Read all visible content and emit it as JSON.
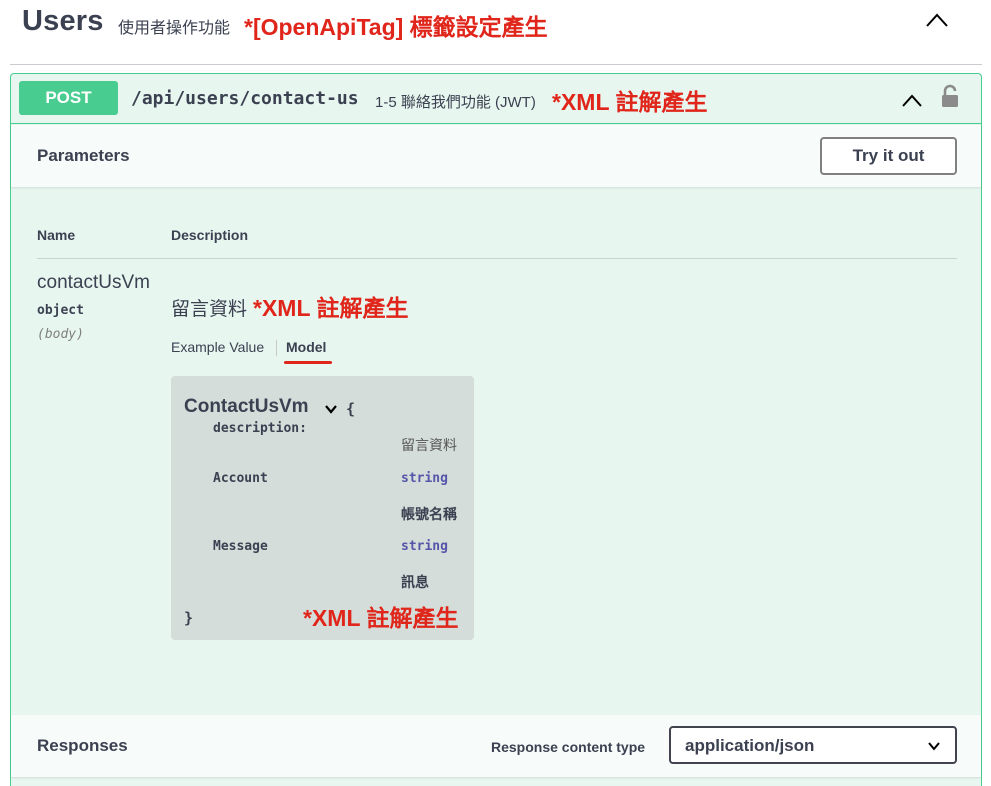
{
  "tag": {
    "name": "Users",
    "description": "使用者操作功能",
    "annotation": "*[OpenApiTag] 標籤設定產生"
  },
  "operation": {
    "method": "POST",
    "path": "/api/users/contact-us",
    "summary": "1-5 聯絡我們功能 (JWT)",
    "annotation": "*XML 註解產生",
    "method_color": "#49cc90"
  },
  "parameters": {
    "title": "Parameters",
    "try_button": "Try it out",
    "column_name": "Name",
    "column_description": "Description",
    "items": [
      {
        "name": "contactUsVm",
        "type": "object",
        "in": "(body)",
        "description": "留言資料",
        "annotation": "*XML 註解產生"
      }
    ],
    "tabs": {
      "example": "Example Value",
      "model": "Model"
    }
  },
  "model": {
    "name": "ContactUsVm",
    "brace_open": "{",
    "brace_close": "}",
    "description_key": "description:",
    "description_value": "留言資料",
    "properties": [
      {
        "key": "Account",
        "type": "string",
        "description": "帳號名稱"
      },
      {
        "key": "Message",
        "type": "string",
        "description": "訊息"
      }
    ],
    "annotation": "*XML 註解產生"
  },
  "responses": {
    "title": "Responses",
    "content_type_label": "Response content type",
    "content_type_value": "application/json"
  },
  "colors": {
    "annotation_red": "#e0261b",
    "post_green": "#49cc90"
  }
}
